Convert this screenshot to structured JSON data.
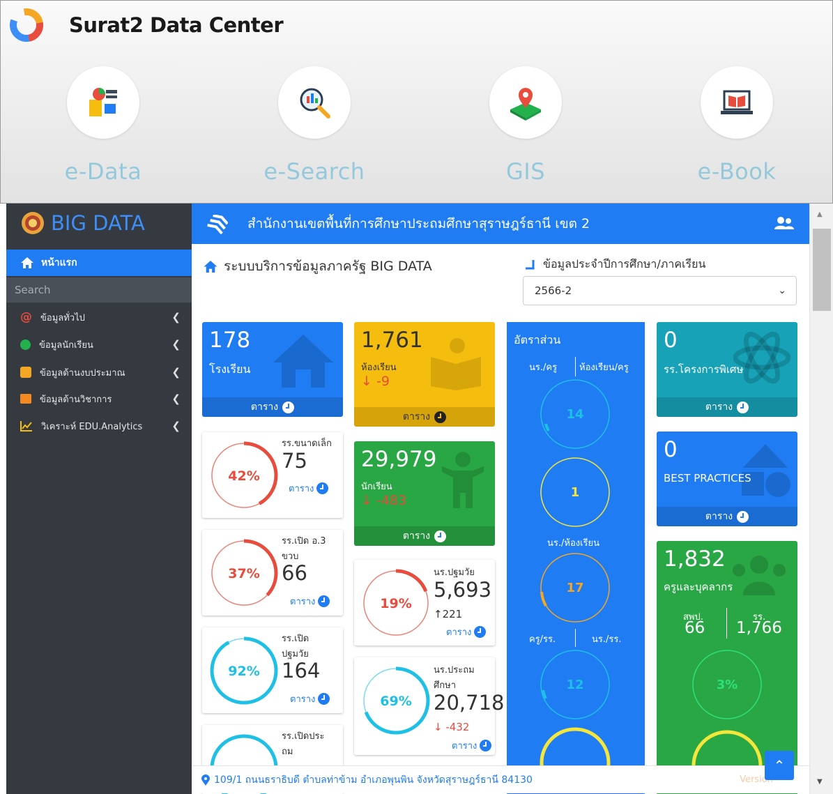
{
  "app": {
    "title": "Surat2 Data Center"
  },
  "modules": [
    {
      "label": "e-Data",
      "icon": "data-analysis-icon"
    },
    {
      "label": "e-Search",
      "icon": "magnifier-chart-icon"
    },
    {
      "label": "GIS",
      "icon": "map-pin-icon"
    },
    {
      "label": "e-Book",
      "icon": "book-laptop-icon"
    }
  ],
  "sidebar": {
    "brand": "BIG DATA",
    "active": "หน้าแรก",
    "search_placeholder": "Search",
    "items": [
      {
        "label": "ข้อมูลทั่วไป",
        "icon": "at-icon",
        "color": "#e84c3d"
      },
      {
        "label": "ข้อมูลนักเรียน",
        "icon": "student-icon",
        "color": "#22b14c"
      },
      {
        "label": "ข้อมูลด้านงบประมาณ",
        "icon": "money-icon",
        "color": "#f5a623"
      },
      {
        "label": "ข้อมูลด้านวิชาการ",
        "icon": "academic-icon",
        "color": "#f58a23"
      },
      {
        "label": "วิเคราะห์ EDU.Analytics",
        "icon": "analytics-chart-icon",
        "color": "#f5bd0d"
      }
    ]
  },
  "header": {
    "title": "สำนักงานเขตพื้นที่การศึกษาประถมศึกษาสุราษฎร์ธานี เขต 2"
  },
  "main": {
    "subtitle": "ระบบบริการข้อมูลภาครัฐ BIG DATA",
    "year_label": "ข้อมูลประจำปีการศึกษา/ภาคเรียน",
    "year_value": "2566-2"
  },
  "cards": {
    "schools": {
      "num": "178",
      "label": "โรงเรียน",
      "link": "ตาราง"
    },
    "rooms": {
      "num": "1,761",
      "label": "ห้องเรียน",
      "delta": "-9",
      "link": "ตาราง"
    },
    "students": {
      "num": "29,979",
      "label": "นักเรียน",
      "delta": "-483",
      "link": "ตาราง"
    },
    "special": {
      "num": "0",
      "label": "รร.โครงการพิเศษ",
      "link": "ตาราง"
    },
    "best": {
      "num": "0",
      "label": "BEST PRACTICES",
      "link": "ตาราง"
    },
    "staff": {
      "num": "1,832",
      "label": "ครูและบุคลากร",
      "h1": "สพป.",
      "v1": "66",
      "h2": "รร.",
      "v2": "1,766",
      "pct": "3%"
    }
  },
  "rings": {
    "small": {
      "pct": "42%",
      "frac": 0.42,
      "t1": "รร.ขนาดเล็ก",
      "t2": "",
      "big": "75",
      "link": "ตาราง"
    },
    "ao3": {
      "pct": "37%",
      "frac": 0.37,
      "t1": "รร.เปิด อ.3",
      "t2": "ขวบ",
      "big": "66",
      "link": "ตาราง"
    },
    "early": {
      "pct": "92%",
      "frac": 0.92,
      "t1": "รร.เปิด",
      "t2": "ปฐมวัย",
      "big": "164",
      "link": "ตาราง"
    },
    "prim_last": {
      "t1": "รร.เปิดประ",
      "t2": "ถม"
    },
    "st_early": {
      "pct": "19%",
      "frac": 0.19,
      "t1": "นร.ปฐมวัย",
      "big": "5,693",
      "delta": "221",
      "link": "ตาราง"
    },
    "st_prim": {
      "pct": "69%",
      "frac": 0.69,
      "t1": "นร.ประถม",
      "t2": "ศึกษา",
      "big": "20,718",
      "delta": "-432",
      "link": "ตาราง"
    }
  },
  "ratio": {
    "title": "อัตราส่วน",
    "h1": "นร./ครู",
    "h2": "ห้องเรียน/ครู",
    "g1": "14",
    "g2": "1",
    "h3": "นร./ห้องเรียน",
    "g3": "17",
    "h4": "ครู/รร.",
    "h5": "นร./รร.",
    "g4": "12"
  },
  "footer": {
    "address": "109/1 ถนนธราธิบดี ตำบลท่าข้าม อำเภอพุนพิน จังหวัดสุราษฎร์ธานี 84130",
    "version": "Version"
  }
}
